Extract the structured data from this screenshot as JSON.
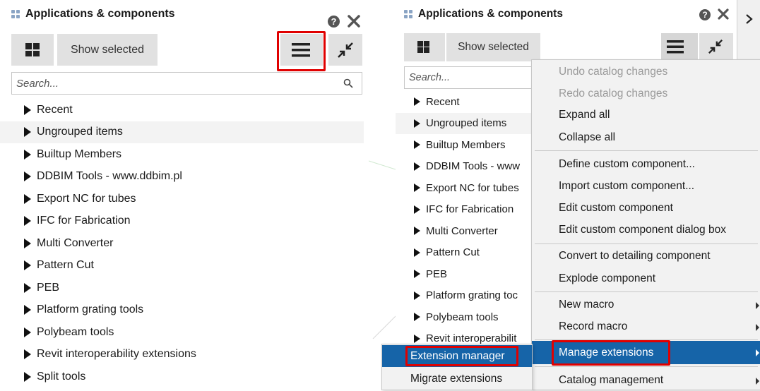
{
  "left_panel": {
    "title": "Applications & components",
    "show_selected": "Show selected",
    "search_placeholder": "Search...",
    "items": [
      "Recent",
      "Ungrouped items",
      "Builtup Members",
      "DDBIM Tools - www.ddbim.pl",
      "Export NC for tubes",
      "IFC for Fabrication",
      "Multi Converter",
      "Pattern Cut",
      "PEB",
      "Platform grating tools",
      "Polybeam tools",
      "Revit interoperability extensions",
      "Split tools"
    ]
  },
  "right_panel": {
    "title": "Applications & components",
    "show_selected": "Show selected",
    "search_placeholder": "Search...",
    "items": [
      "Recent",
      "Ungrouped items",
      "Builtup Members",
      "DDBIM Tools - www",
      "Export NC for tubes",
      "IFC for Fabrication",
      "Multi Converter",
      "Pattern Cut",
      "PEB",
      "Platform grating toc",
      "Polybeam tools",
      "Revit interoperabilit"
    ]
  },
  "context_menu": {
    "items": [
      "Undo catalog changes",
      "Redo catalog changes",
      "Expand all",
      "Collapse all",
      "Define custom component...",
      "Import custom component...",
      "Edit custom component",
      "Edit custom component dialog box",
      "Convert to detailing component",
      "Explode component",
      "New macro",
      "Record macro",
      "Manage extensions",
      "Catalog management"
    ]
  },
  "submenu": {
    "items": [
      "Extension manager",
      "Migrate extensions"
    ]
  },
  "colors": {
    "highlight_red": "#e00000",
    "menu_selected": "#1664a8",
    "toolbar_bg": "#e1e1e1",
    "row_alt": "#f3f3f3"
  },
  "icons": [
    "grid-view-icon",
    "menu-icon",
    "collapse-arrows-icon",
    "help-icon",
    "close-icon",
    "search-icon",
    "chevron-right-icon"
  ]
}
